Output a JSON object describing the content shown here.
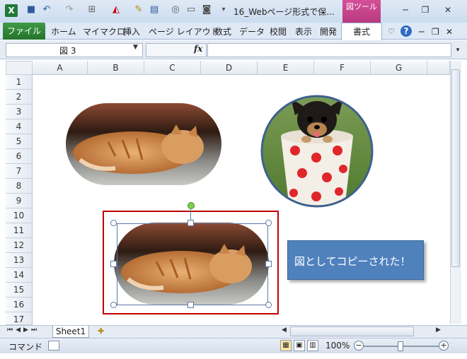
{
  "window": {
    "title": "16_Webページ形式で保...",
    "context_tab": "図ツール"
  },
  "ribbon": {
    "file_tab": "ファイル",
    "tabs": [
      "ホーム",
      "マイマクロ",
      "挿入",
      "ページ レイアウト",
      "数式",
      "データ",
      "校閲",
      "表示",
      "開発"
    ],
    "active_tab": "書式"
  },
  "formula_bar": {
    "name_box": "図 3",
    "fx": "fx",
    "formula": ""
  },
  "grid": {
    "columns": [
      "A",
      "B",
      "C",
      "D",
      "E",
      "F",
      "G"
    ],
    "rows": [
      "1",
      "2",
      "3",
      "4",
      "5",
      "6",
      "7",
      "8",
      "9",
      "10",
      "11",
      "12",
      "13",
      "14",
      "15",
      "16",
      "17"
    ]
  },
  "sheet": {
    "tab": "Sheet1"
  },
  "callout": {
    "text": "図としてコピーされた！"
  },
  "status": {
    "mode": "コマンド",
    "zoom": "100%"
  },
  "icons": [
    "excel-icon",
    "save-icon",
    "undo-icon",
    "redo-icon",
    "borders-icon",
    "fill-color-icon",
    "format-painter-icon",
    "paste-icon",
    "print-preview-icon",
    "print-icon",
    "camera-icon",
    "minimize-icon",
    "restore-icon",
    "close-icon",
    "help-icon"
  ]
}
